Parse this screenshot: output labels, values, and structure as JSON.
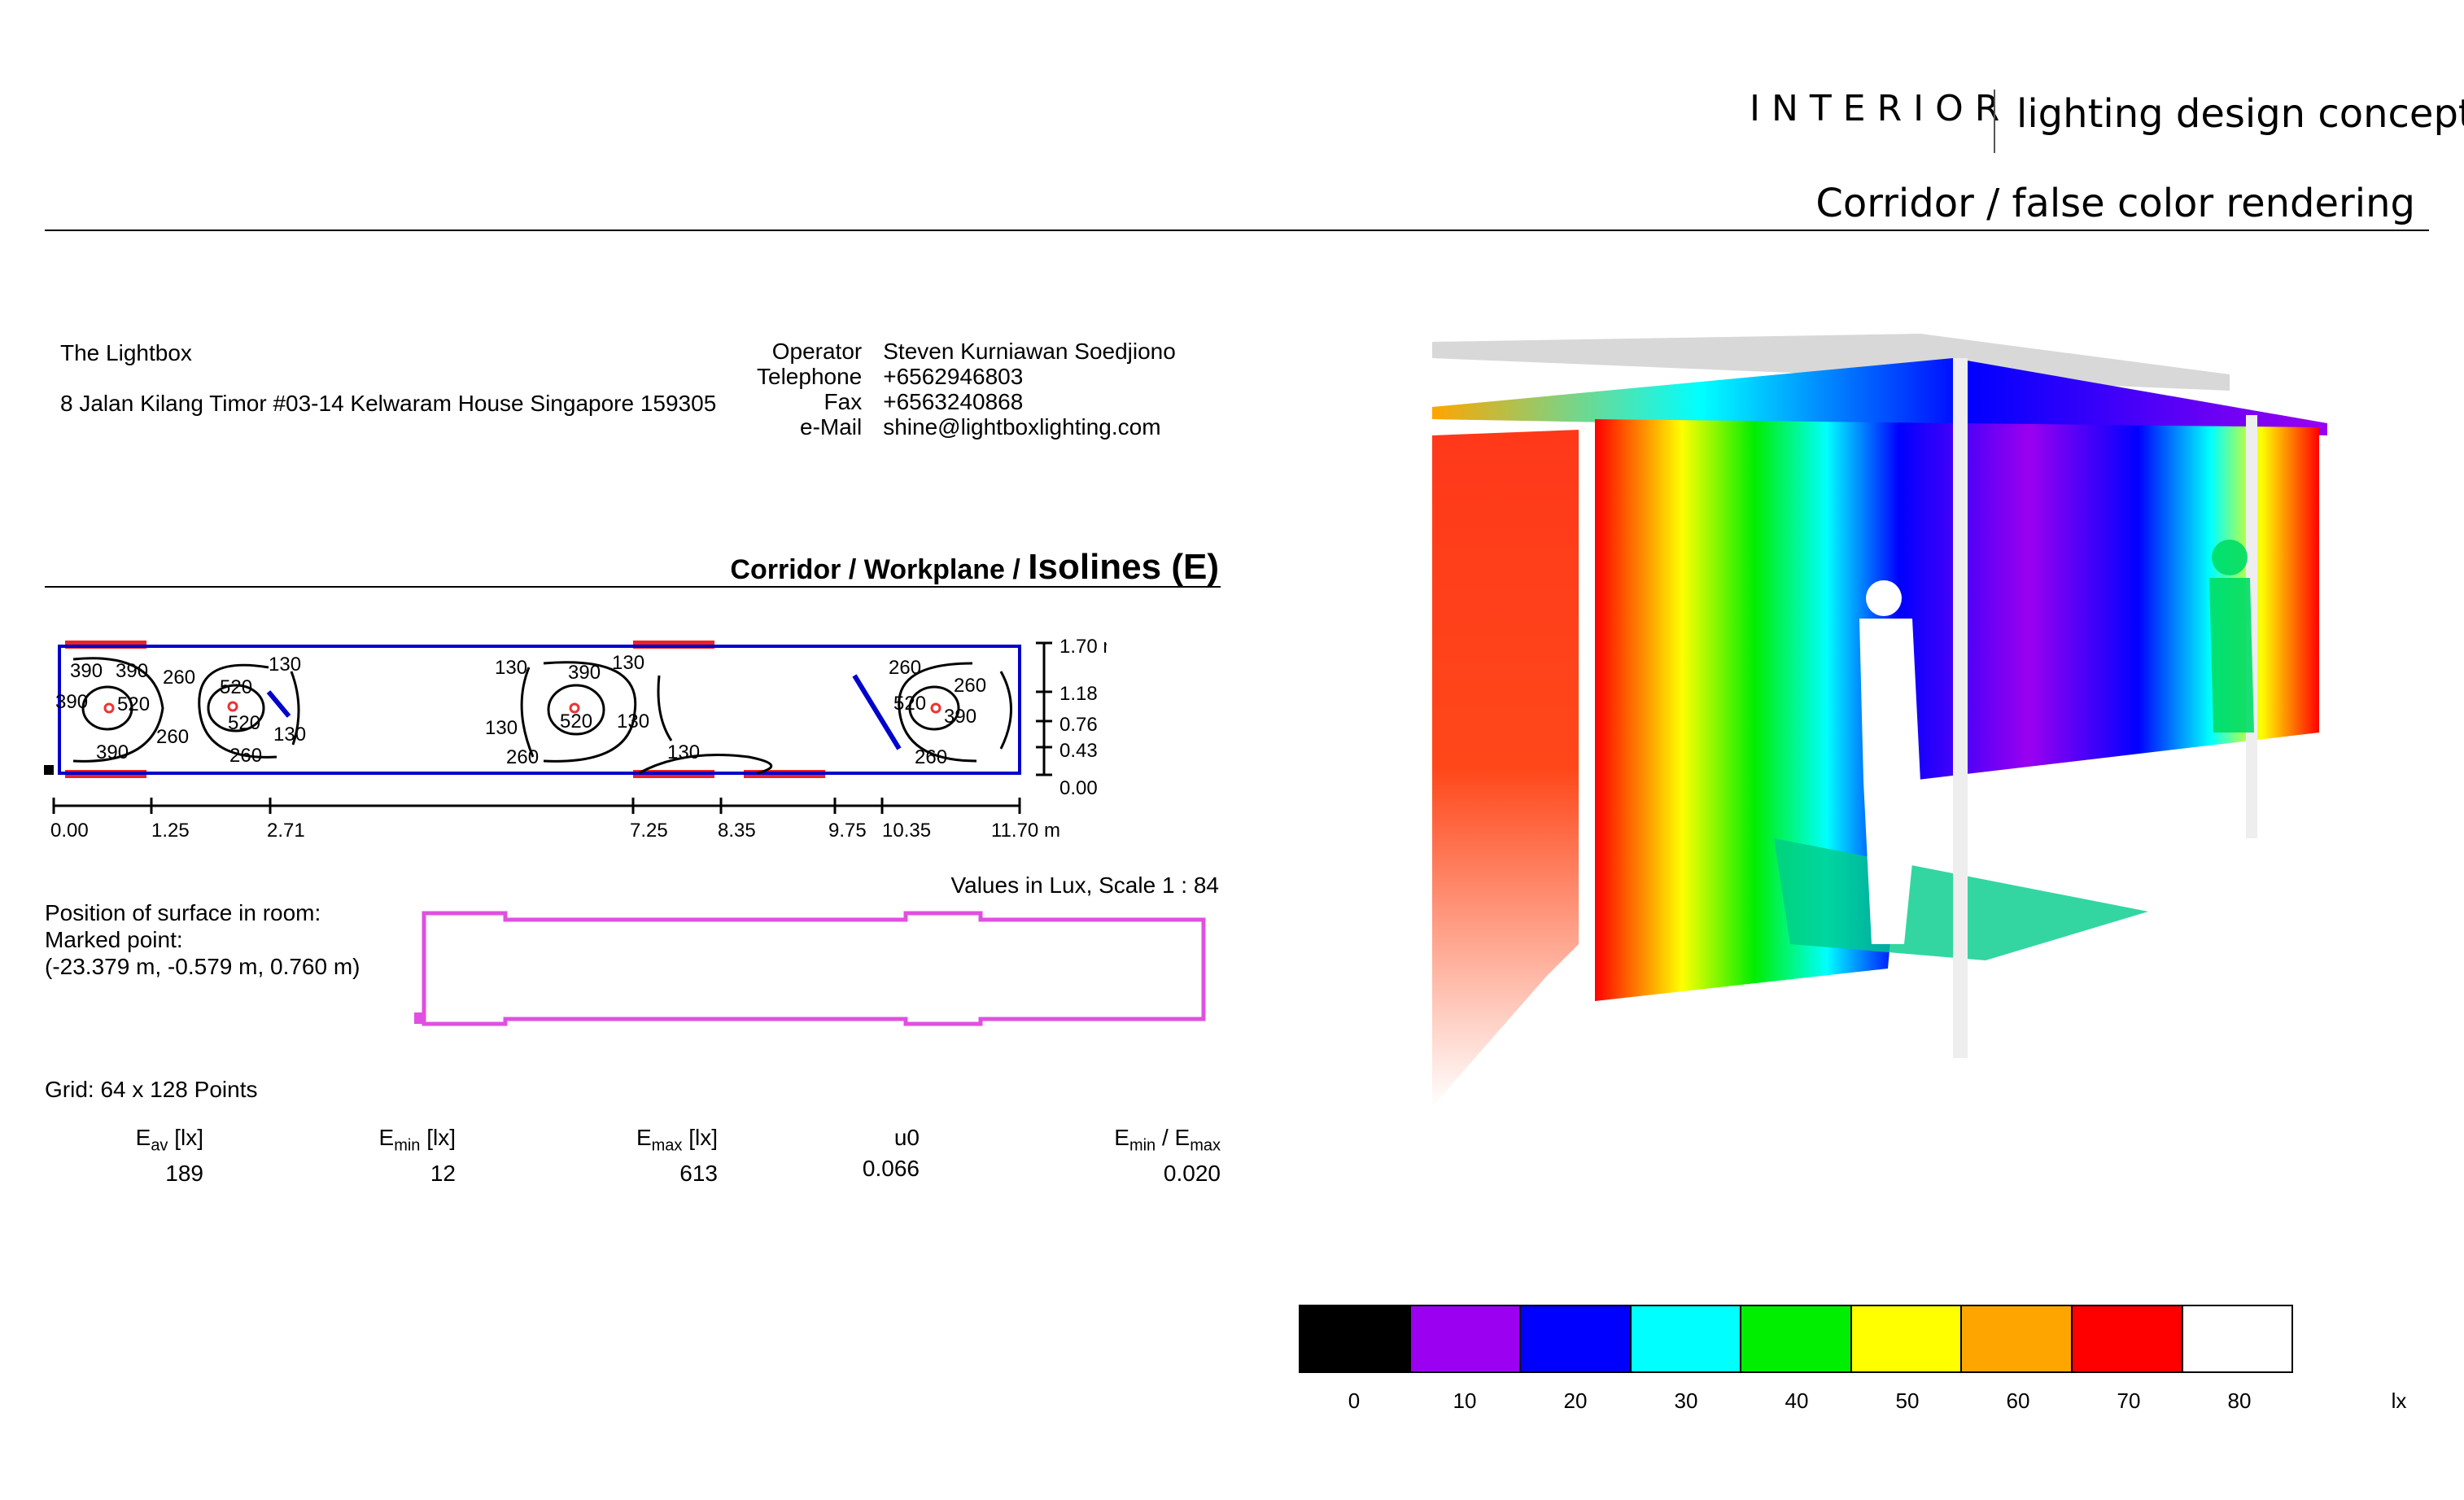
{
  "header": {
    "brand": "INTERIOR",
    "concept": "lighting design concept",
    "page_subtitle": "Corridor / false color rendering"
  },
  "company": {
    "name": "The Lightbox",
    "address": "8 Jalan Kilang Timor #03-14 Kelwaram House Singapore 159305"
  },
  "contact": [
    {
      "label": "Operator",
      "value": "Steven Kurniawan Soedjiono"
    },
    {
      "label": "Telephone",
      "value": "+6562946803"
    },
    {
      "label": "Fax",
      "value": "+6563240868"
    },
    {
      "label": "e-Mail",
      "value": "shine@lightboxlighting.com"
    }
  ],
  "plot": {
    "title_prefix": "Corridor / Workplane / ",
    "title_main": "Isolines (E)",
    "x_ticks": [
      "0.00",
      "1.25",
      "2.71",
      "7.25",
      "8.35",
      "9.75",
      "10.35",
      "11.70 m"
    ],
    "y_ticks": [
      "1.70 m",
      "1.18",
      "0.76",
      "0.43",
      "0.00"
    ],
    "contour_labels": [
      "390",
      "390",
      "260",
      "390",
      "520",
      "520",
      "130",
      "520",
      "260",
      "130",
      "390",
      "260",
      "130",
      "390",
      "130",
      "130",
      "520",
      "130",
      "260",
      "130",
      "260",
      "260",
      "520",
      "390",
      "260"
    ],
    "scale_note": "Values in Lux, Scale 1 : 84"
  },
  "position": {
    "line1": "Position of surface in room:",
    "line2": "Marked point:",
    "line3": "(-23.379 m, -0.579 m, 0.760 m)"
  },
  "grid": "Grid: 64 x 128 Points",
  "stats": [
    {
      "sym": "E",
      "sub": "av",
      "unit": " [lx]",
      "value": "189"
    },
    {
      "sym": "E",
      "sub": "min",
      "unit": " [lx]",
      "value": "12"
    },
    {
      "sym": "E",
      "sub": "max",
      "unit": " [lx]",
      "value": "613"
    },
    {
      "sym": "u0",
      "sub": "",
      "unit": "",
      "value": "0.066"
    },
    {
      "sym": "E",
      "sub": "min",
      "unit": " / E",
      "sub2": "max",
      "value": "0.020"
    }
  ],
  "color_scale": {
    "labels": [
      "0",
      "10",
      "20",
      "30",
      "40",
      "50",
      "60",
      "70",
      "80"
    ],
    "colors": [
      "#000000",
      "#9b00f0",
      "#0000ff",
      "#00ffff",
      "#00ee00",
      "#ffff00",
      "#ffa500",
      "#ff0000",
      "#ffffff"
    ],
    "unit": "lx"
  },
  "colors": {
    "outline_pink": "#e050e0",
    "plan_blue": "#0000cc",
    "luminaire_red": "#ee2222"
  }
}
